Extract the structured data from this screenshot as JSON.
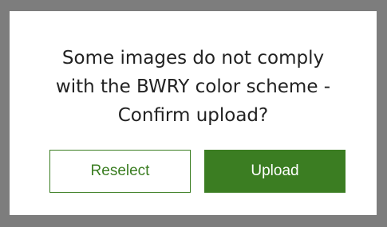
{
  "dialog": {
    "message_lines": [
      "Some images do not comply",
      "with the BWRY color scheme -",
      "Confirm upload?"
    ],
    "buttons": {
      "reselect_label": "Reselect",
      "upload_label": "Upload"
    }
  },
  "colors": {
    "overlay": "#7d7d7d",
    "dialog_background": "#ffffff",
    "accent_green": "#3b7d22",
    "text": "#222222"
  }
}
